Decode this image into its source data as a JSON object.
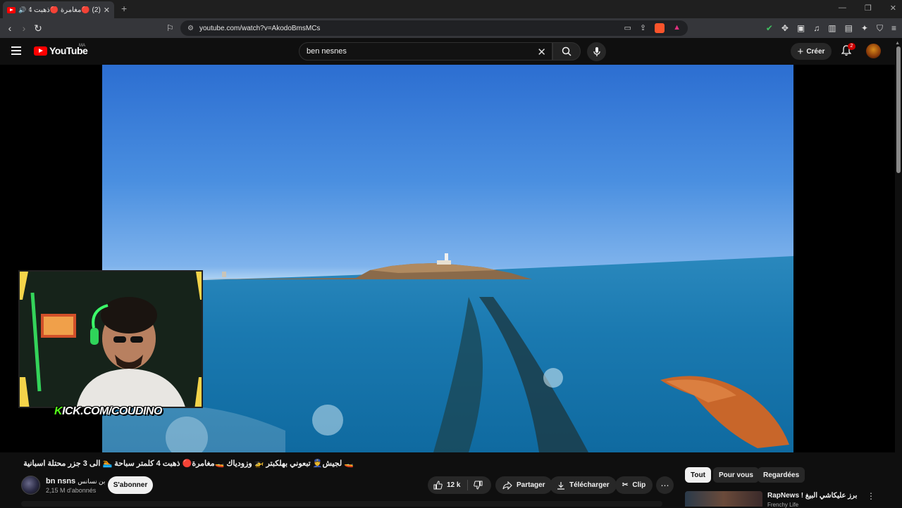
{
  "browser": {
    "tab_title": "(2) 🔴مغامرة 🔴ذهبت 4 كلمتر",
    "url": "youtube.com/watch?v=AkodoBmsMCs",
    "window_controls": [
      "—",
      "❐",
      "✕"
    ]
  },
  "youtube": {
    "logo_text": "YouTube",
    "region": "MA",
    "search_value": "ben nesnes",
    "create_label": "Créer",
    "notification_count": "2"
  },
  "overlay": {
    "kick_prefix": "K",
    "kick_rest": "ICK.COM/COUDINO"
  },
  "video": {
    "title": "🚤 لجيش👮 تبعوني بهلكبتر 🚁 وزودياك 🚤مغامرة🔴 ذهبت 4 كلمتر سباحة 🏊 الى 3 جزر محتلة اسبانية 🚨",
    "channel_name": "bn nsns",
    "channel_name_ar": "بن نسانس",
    "subscribers": "2,15 M d'abonnés",
    "subscribe_label": "S'abonner",
    "likes": "12 k",
    "share_label": "Partager",
    "download_label": "Télécharger",
    "clip_label": "Clip"
  },
  "chips": [
    "Tout",
    "Pour vous",
    "Regardées"
  ],
  "recommendation": {
    "title": "RapNews ! برز عليكاشي البيغ",
    "channel": "Frenchy Life"
  }
}
